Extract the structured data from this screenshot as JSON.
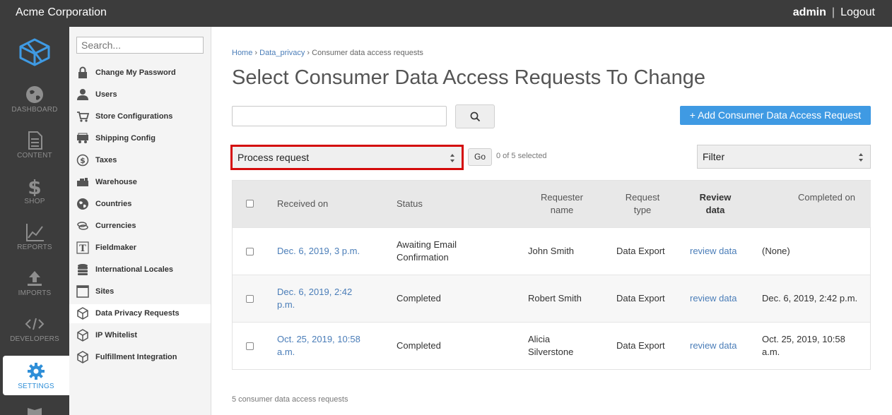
{
  "topbar": {
    "brand": "Acme Corporation",
    "user": "admin",
    "separator": "|",
    "logout": "Logout"
  },
  "iconnav": {
    "items": [
      {
        "label": "DASHBOARD",
        "icon": "globe-icon"
      },
      {
        "label": "CONTENT",
        "icon": "document-icon"
      },
      {
        "label": "SHOP",
        "icon": "dollar-icon"
      },
      {
        "label": "REPORTS",
        "icon": "chart-icon"
      },
      {
        "label": "IMPORTS",
        "icon": "upload-icon"
      },
      {
        "label": "DEVELOPERS",
        "icon": "code-icon"
      },
      {
        "label": "SETTINGS",
        "icon": "gear-icon",
        "active": true
      }
    ]
  },
  "subnav": {
    "search_placeholder": "Search...",
    "items": [
      {
        "label": "Change My Password",
        "icon": "lock-icon"
      },
      {
        "label": "Users",
        "icon": "user-icon"
      },
      {
        "label": "Store Configurations",
        "icon": "cart-icon"
      },
      {
        "label": "Shipping Config",
        "icon": "truck-icon"
      },
      {
        "label": "Taxes",
        "icon": "coin-icon"
      },
      {
        "label": "Warehouse",
        "icon": "warehouse-icon"
      },
      {
        "label": "Countries",
        "icon": "globe-icon"
      },
      {
        "label": "Currencies",
        "icon": "money-icon"
      },
      {
        "label": "Fieldmaker",
        "icon": "text-icon"
      },
      {
        "label": "International Locales",
        "icon": "database-icon"
      },
      {
        "label": "Sites",
        "icon": "window-icon"
      },
      {
        "label": "Data Privacy Requests",
        "icon": "box-icon",
        "active": true
      },
      {
        "label": "IP Whitelist",
        "icon": "box-icon"
      },
      {
        "label": "Fulfillment Integration",
        "icon": "box-icon"
      }
    ]
  },
  "main": {
    "breadcrumb": {
      "home": "Home",
      "sep1": "›",
      "section": "Data_privacy",
      "sep2": "›",
      "current": "Consumer data access requests"
    },
    "title": "Select Consumer Data Access Requests To Change",
    "add_button": "+  Add Consumer Data Access Request",
    "action_select": "Process request",
    "go_button": "Go",
    "selected_count": "0 of 5 selected",
    "filter_select": "Filter",
    "table": {
      "headers": {
        "received_on": "Received on",
        "status": "Status",
        "requester_line1": "Requester",
        "requester_line2": "name",
        "type_line1": "Request",
        "type_line2": "type",
        "review_line1": "Review",
        "review_line2": "data",
        "completed_on": "Completed on"
      },
      "rows": [
        {
          "received_1": "Dec. 6, 2019, 3 p.m.",
          "received_2": "",
          "status_1": "Awaiting Email",
          "status_2": "Confirmation",
          "requester_1": "John Smith",
          "requester_2": "",
          "type": "Data Export",
          "review": "review data",
          "completed_1": "(None)",
          "completed_2": ""
        },
        {
          "received_1": "Dec. 6, 2019, 2:42",
          "received_2": "p.m.",
          "status_1": "Completed",
          "status_2": "",
          "requester_1": "Robert Smith",
          "requester_2": "",
          "type": "Data Export",
          "review": "review data",
          "completed_1": "Dec. 6, 2019, 2:42 p.m.",
          "completed_2": ""
        },
        {
          "received_1": "Oct. 25, 2019, 10:58",
          "received_2": "a.m.",
          "status_1": "Completed",
          "status_2": "",
          "requester_1": "Alicia",
          "requester_2": "Silverstone",
          "type": "Data Export",
          "review": "review data",
          "completed_1": "Oct. 25, 2019, 10:58",
          "completed_2": "a.m."
        }
      ]
    },
    "footer_count": "5 consumer data access requests"
  },
  "colors": {
    "topbar": "#3c3c3c",
    "accent": "#3f9ae3",
    "link": "#4a7db8",
    "highlight_border": "#d40b0b"
  }
}
